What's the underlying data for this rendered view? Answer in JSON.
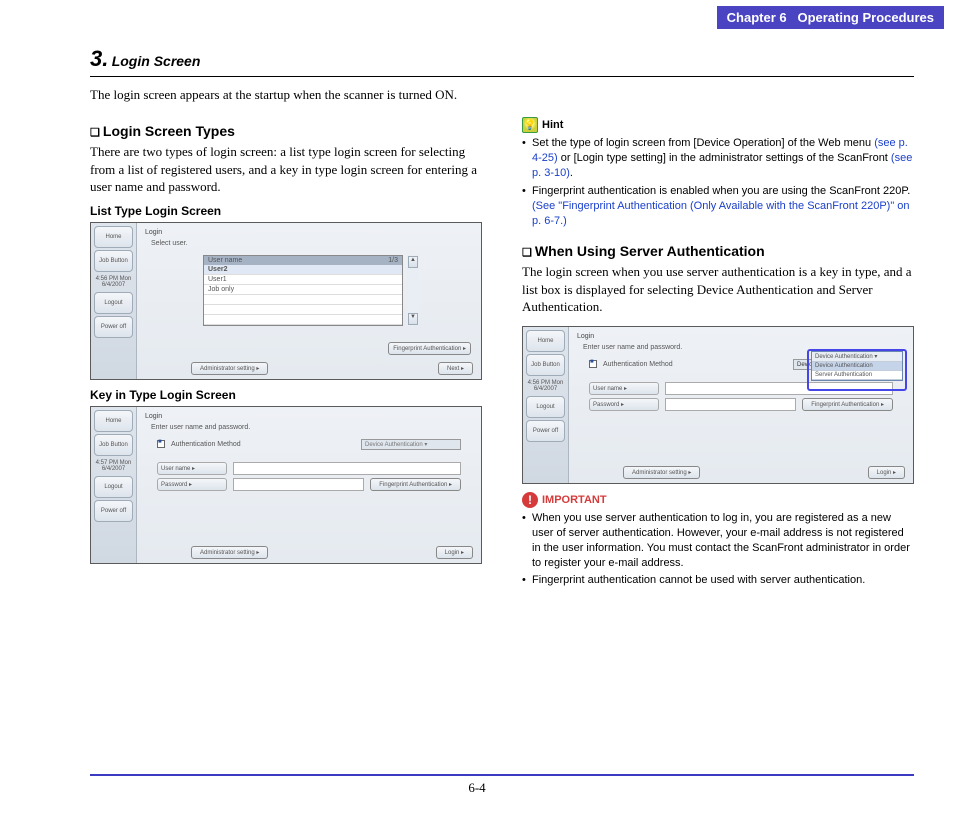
{
  "chapter": {
    "num": "Chapter 6",
    "title": "Operating Procedures"
  },
  "section": {
    "num": "3.",
    "title": "Login Screen"
  },
  "intro": "The login screen appears at the startup when the scanner is turned ON.",
  "col1": {
    "types_head": "Login Screen Types",
    "types_body": "There are two types of login screen: a list type login screen for selecting from a list of registered users, and a key in type login screen for entering a user name and password.",
    "list_label": "List Type Login Screen",
    "key_label": "Key in Type Login Screen"
  },
  "shot1": {
    "home": "Home",
    "job": "Job Button",
    "time": "4:56 PM  Mon 6/4/2007",
    "logout": "Logout",
    "power": "Power off",
    "title": "Login",
    "instr": "Select user.",
    "col_head": "User name",
    "page_ind": "1/3",
    "rows": [
      "User2",
      "User1",
      "Job only",
      "",
      "",
      ""
    ],
    "fp": "Fingerprint Authentication  ▸",
    "admin": "Administrator setting   ▸",
    "next": "Next            ▸"
  },
  "shot2": {
    "home": "Home",
    "job": "Job Button",
    "time": "4:57 PM  Mon 6/4/2007",
    "logout": "Logout",
    "power": "Power off",
    "title": "Login",
    "instr": "Enter user name and password.",
    "auth_lbl": "Authentication Method",
    "auth_val": "Device Authentication  ▾",
    "user_lbl": "User name   ▸",
    "pass_lbl": "Password    ▸",
    "fp": "Fingerprint Authentication  ▸",
    "admin": "Administrator setting   ▸",
    "login": "Login           ▸"
  },
  "col2": {
    "hint_label": "Hint",
    "hint1a": "Set the type of login screen from [Device Operation] of the Web menu ",
    "hint1_link1": "(see p. 4-25)",
    "hint1b": " or [Login type setting] in the administrator settings of the ScanFront ",
    "hint1_link2": "(see p. 3-10)",
    "hint1c": ".",
    "hint2a": "Fingerprint authentication is enabled when you are using the ScanFront 220P. ",
    "hint2_link": "(See \"Fingerprint Authentication (Only Available with the ScanFront 220P)\" on p. 6-7.)",
    "server_head": "When Using Server Authentication",
    "server_body": "The login screen when you use server authentication is a key in type, and a list box is displayed for selecting Device Authentication and Server Authentication."
  },
  "shot3": {
    "home": "Home",
    "job": "Job Button",
    "time": "4:56 PM  Mon 6/4/2007",
    "logout": "Logout",
    "power": "Power off",
    "title": "Login",
    "instr": "Enter user name and password.",
    "auth_lbl": "Authentication Method",
    "auth_val": "Device Authentication  ▾",
    "dd_opt1": "Device Authentication",
    "dd_opt2": "Server Authentication",
    "user_lbl": "User name   ▸",
    "pass_lbl": "Password    ▸",
    "fp": "Fingerprint Authentication  ▸",
    "admin": "Administrator setting   ▸",
    "login": "Login           ▸"
  },
  "important": {
    "label": "IMPORTANT",
    "b1": "When you use server authentication to log in, you are registered as a new user of server authentication. However, your e-mail address is not registered in the user information. You must contact the ScanFront administrator in order to register your e-mail address.",
    "b2": "Fingerprint authentication cannot be used with server authentication."
  },
  "page_num": "6-4"
}
